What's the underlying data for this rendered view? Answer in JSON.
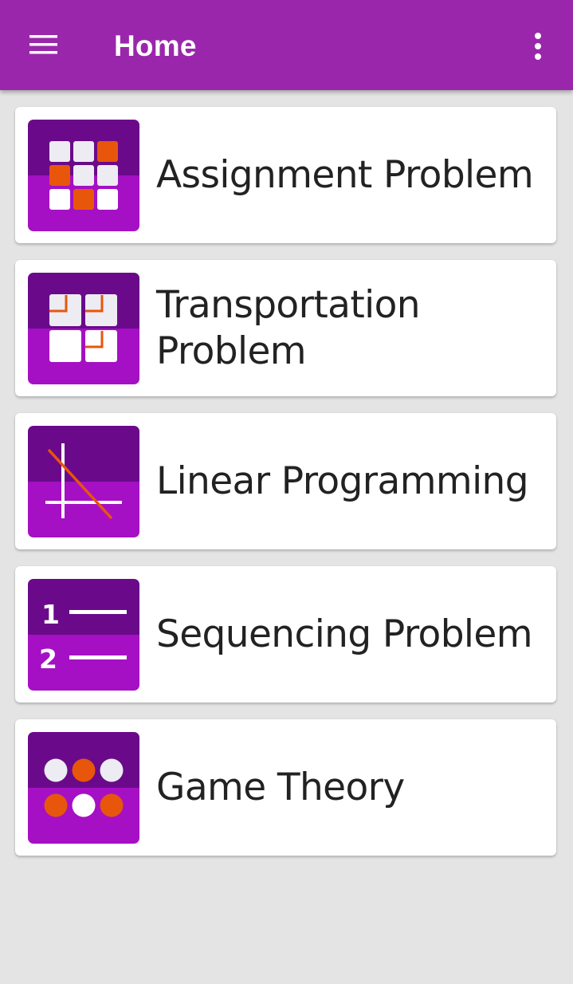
{
  "app_bar": {
    "title": "Home",
    "menu_icon": "hamburger-menu-icon",
    "overflow_icon": "more-vert-icon",
    "color": "#9a27ab"
  },
  "colors": {
    "icon_dark": "#6a0a8a",
    "icon_light": "#a510c4",
    "accent_orange": "#e8560c",
    "tile_white": "#ececf2"
  },
  "topics": [
    {
      "label": "Assignment Problem",
      "icon": "assignment-grid-icon"
    },
    {
      "label": "Transportation Problem",
      "icon": "transportation-grid-icon"
    },
    {
      "label": "Linear Programming",
      "icon": "linear-graph-icon"
    },
    {
      "label": "Sequencing Problem",
      "icon": "numbered-list-icon"
    },
    {
      "label": "Game Theory",
      "icon": "game-dots-icon"
    }
  ]
}
